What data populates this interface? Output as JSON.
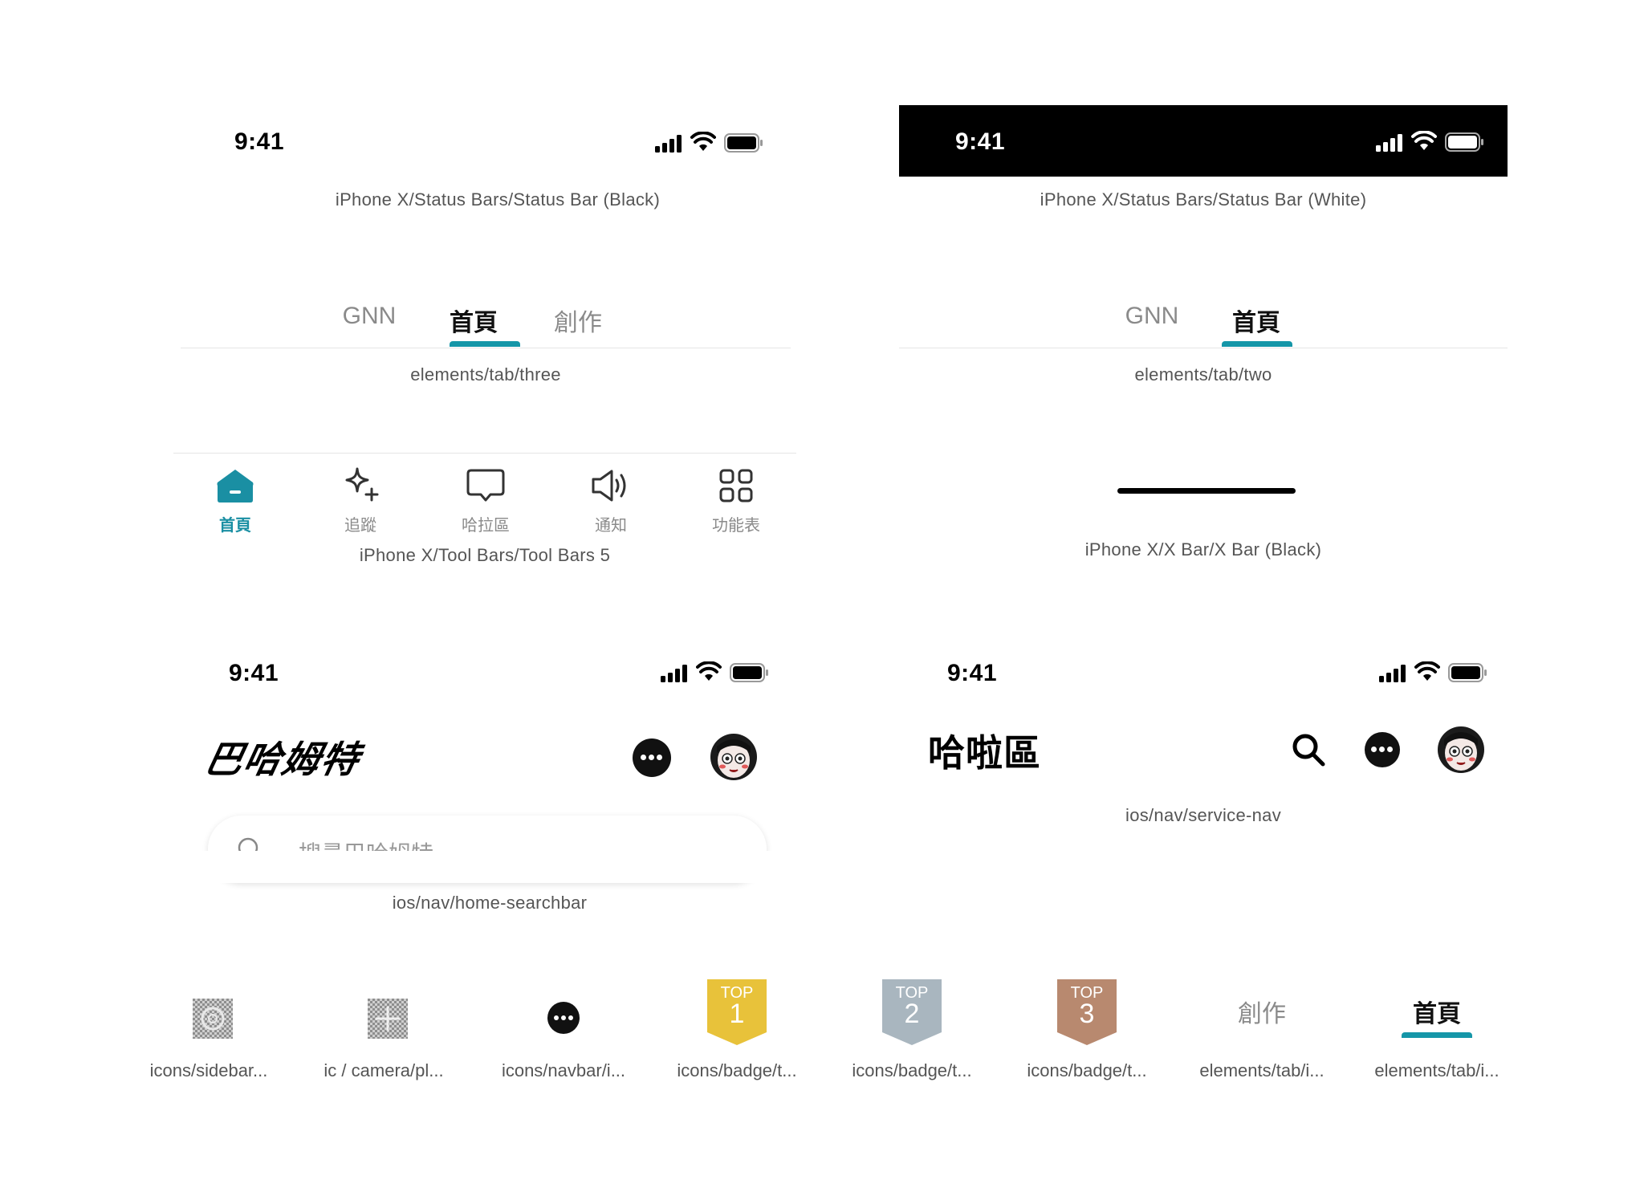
{
  "status_bar_black": {
    "time": "9:41",
    "caption": "iPhone X/Status Bars/Status Bar (Black)"
  },
  "status_bar_white": {
    "time": "9:41",
    "caption": "iPhone X/Status Bars/Status Bar (White)"
  },
  "tab_three": {
    "tabs": [
      {
        "label": "GNN",
        "active": false
      },
      {
        "label": "首頁",
        "active": true
      },
      {
        "label": "創作",
        "active": false
      }
    ],
    "caption": "elements/tab/three"
  },
  "tab_two": {
    "tabs": [
      {
        "label": "GNN",
        "active": false
      },
      {
        "label": "首頁",
        "active": true
      }
    ],
    "caption": "elements/tab/two"
  },
  "tool_bar": {
    "items": [
      {
        "label": "首頁",
        "icon": "home-icon",
        "active": true
      },
      {
        "label": "追蹤",
        "icon": "sparkle-plus-icon",
        "active": false
      },
      {
        "label": "哈拉區",
        "icon": "chat-bubble-icon",
        "active": false
      },
      {
        "label": "通知",
        "icon": "speaker-icon",
        "active": false
      },
      {
        "label": "功能表",
        "icon": "grid-icon",
        "active": false
      }
    ],
    "caption": "iPhone X/Tool Bars/Tool Bars 5",
    "active_color": "#1a8fa3"
  },
  "x_bar": {
    "caption": "iPhone X/X Bar/X Bar (Black)"
  },
  "home_searchbar": {
    "time": "9:41",
    "logo_text": "巴哈姆特",
    "search_placeholder": "搜尋巴哈姆特",
    "caption": "ios/nav/home-searchbar"
  },
  "service_nav": {
    "time": "9:41",
    "title": "哈啦區",
    "caption": "ios/nav/service-nav"
  },
  "components": [
    {
      "caption": "icons/sidebar...",
      "kind": "gear-placeholder-icon"
    },
    {
      "caption": "ic / camera/pl...",
      "kind": "camera-placeholder-icon"
    },
    {
      "caption": "icons/navbar/i...",
      "kind": "chat-icon"
    },
    {
      "caption": "icons/badge/t...",
      "kind": "badge",
      "badge_top": "TOP",
      "badge_num": "1",
      "color": "#e8c23a"
    },
    {
      "caption": "icons/badge/t...",
      "kind": "badge",
      "badge_top": "TOP",
      "badge_num": "2",
      "color": "#a9b6bf"
    },
    {
      "caption": "icons/badge/t...",
      "kind": "badge",
      "badge_top": "TOP",
      "badge_num": "3",
      "color": "#b8896f"
    },
    {
      "caption": "elements/tab/i...",
      "kind": "tab",
      "label": "創作",
      "active": false
    },
    {
      "caption": "elements/tab/i...",
      "kind": "tab",
      "label": "首頁",
      "active": true
    }
  ],
  "colors": {
    "accent": "#1596a8",
    "caption": "#555555",
    "inactive": "#8a8a8a"
  }
}
